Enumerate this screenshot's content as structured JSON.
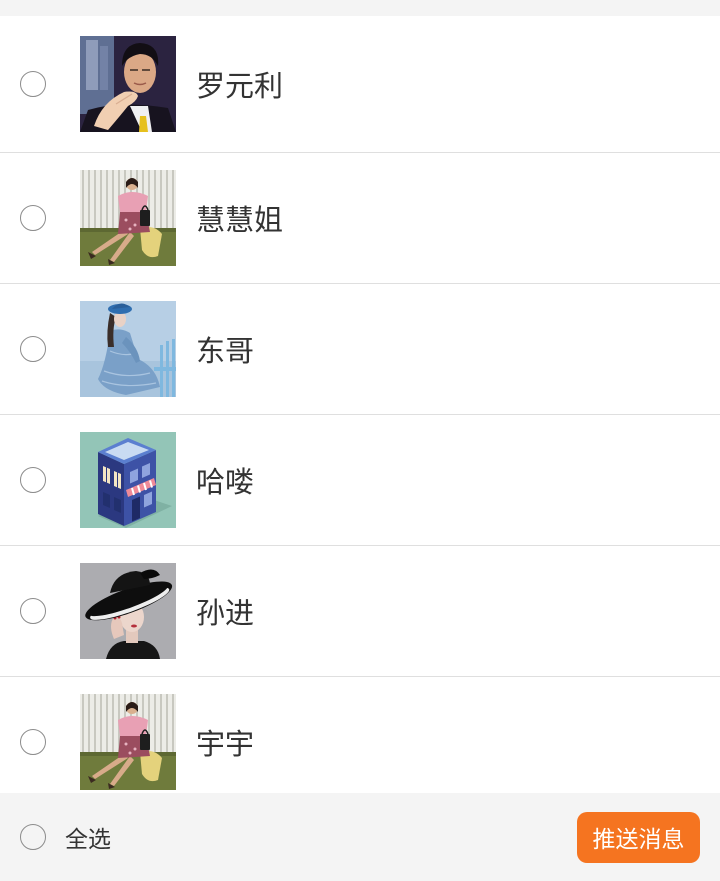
{
  "colors": {
    "accent": "#f57420",
    "page_bg": "#f4f4f4",
    "divider": "#dfdfdf",
    "text": "#333333"
  },
  "contacts": [
    {
      "name": "罗元利",
      "checked": false
    },
    {
      "name": "慧慧姐",
      "checked": false
    },
    {
      "name": "东哥",
      "checked": false
    },
    {
      "name": "哈喽",
      "checked": false
    },
    {
      "name": "孙进",
      "checked": false
    },
    {
      "name": "宇宇",
      "checked": false
    }
  ],
  "footer": {
    "select_all_label": "全选",
    "select_all_checked": false,
    "push_button_label": "推送消息"
  }
}
